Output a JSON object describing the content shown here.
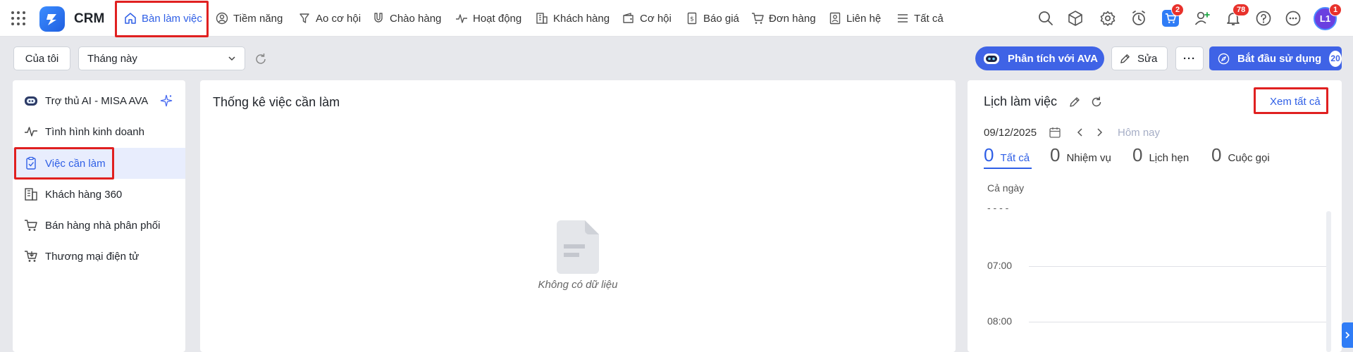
{
  "app": {
    "brand": "CRM"
  },
  "nav": {
    "items": [
      {
        "label": "Bàn làm việc",
        "icon": "home-icon",
        "active": true
      },
      {
        "label": "Tiềm năng",
        "icon": "person-circle-icon"
      },
      {
        "label": "Ao cơ hội",
        "icon": "funnel-icon"
      },
      {
        "label": "Chào hàng",
        "icon": "magnet-icon"
      },
      {
        "label": "Hoạt động",
        "icon": "pulse-icon"
      },
      {
        "label": "Khách hàng",
        "icon": "building-icon"
      },
      {
        "label": "Cơ hội",
        "icon": "wallet-icon"
      },
      {
        "label": "Báo giá",
        "icon": "invoice-icon"
      },
      {
        "label": "Đơn hàng",
        "icon": "cart-icon"
      },
      {
        "label": "Liên hệ",
        "icon": "contact-card-icon"
      },
      {
        "label": "Tất cả",
        "icon": "menu-lines-icon"
      }
    ]
  },
  "header_badges": {
    "cart": "2",
    "notifications": "78",
    "avatar": "1"
  },
  "user": {
    "initials": "L1"
  },
  "toolbar": {
    "owner_filter": "Của tôi",
    "period_select": "Tháng này",
    "analyze_button": "Phân tích với AVA",
    "edit_button": "Sửa",
    "more_button": "···",
    "start_button": "Bắt đầu sử dụng",
    "start_count": "20"
  },
  "sidebar": {
    "items": [
      {
        "label": "Trợ thủ AI - MISA AVA",
        "icon": "robot-icon"
      },
      {
        "label": "Tình hình kinh doanh",
        "icon": "pulse-icon"
      },
      {
        "label": "Việc cần làm",
        "icon": "clipboard-check-icon",
        "active": true
      },
      {
        "label": "Khách hàng 360",
        "icon": "building-icon"
      },
      {
        "label": "Bán hàng nhà phân phối",
        "icon": "cart-icon"
      },
      {
        "label": "Thương mại điện tử",
        "icon": "cart-download-icon"
      }
    ]
  },
  "todo": {
    "title": "Thống kê việc cần làm",
    "empty_text": "Không có dữ liệu"
  },
  "calendar": {
    "title": "Lịch làm việc",
    "view_all": "Xem tất cả",
    "date": "09/12/2025",
    "today": "Hôm nay",
    "tabs": [
      {
        "count": "0",
        "label": "Tất cả",
        "active": true
      },
      {
        "count": "0",
        "label": "Nhiệm vụ"
      },
      {
        "count": "0",
        "label": "Lịch hẹn"
      },
      {
        "count": "0",
        "label": "Cuộc gọi"
      }
    ],
    "all_day": "Cả ngày",
    "times": [
      "07:00",
      "08:00"
    ]
  },
  "colors": {
    "accent": "#2f5fe6",
    "highlight": "#e02020",
    "badge": "#e8312b"
  }
}
